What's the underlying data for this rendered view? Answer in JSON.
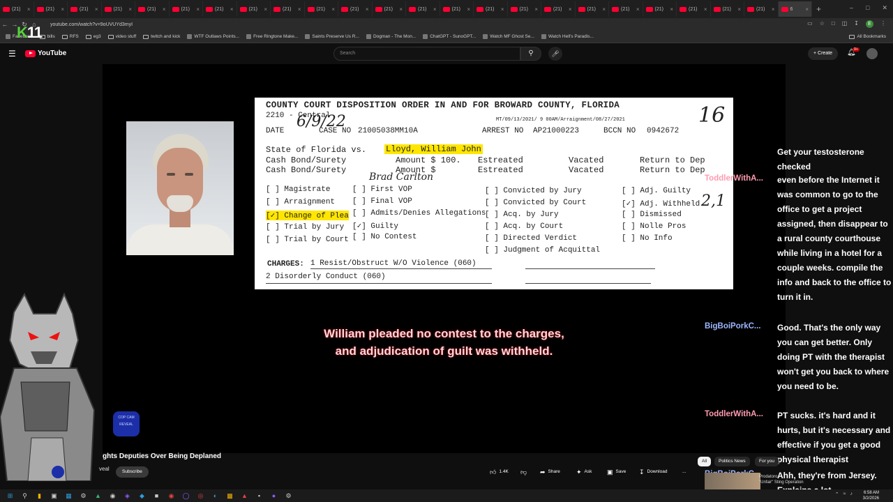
{
  "browser": {
    "tabs": [
      "(21)",
      "(21)",
      "(21)",
      "(21)",
      "(21)",
      "(21)",
      "(21)",
      "(21)",
      "(21)",
      "(21)",
      "(21)",
      "(21)",
      "(21)",
      "(21)",
      "(21)",
      "(21)",
      "(21)",
      "(21)",
      "(21)",
      "(21)",
      "(21)",
      "(21)",
      "(21)"
    ],
    "active_tab": "6",
    "new_tab": "+",
    "url": "youtube.com/watch?v=9oUVUYd3myI",
    "bookmarks": [
      "Facebook",
      "bills",
      "RFS",
      "eg3",
      "video stuff",
      "twitch and kick",
      "WTF Outlaws Points...",
      "Free Ringtone Make...",
      "Saints Preserve Us R...",
      "Dogman - The Mon...",
      "ChatGPT - SunoGPT...",
      "Watch MF Ghost Se...",
      "Watch Hell's Paradis..."
    ],
    "all_bookmarks": "All Bookmarks",
    "profile_initial": "E"
  },
  "overlay": {
    "logo_k": "K",
    "logo_num": "11"
  },
  "youtube": {
    "logo": "YouTube",
    "search_placeholder": "Search",
    "create": "Create",
    "notif_badge": "9+"
  },
  "document": {
    "title": "COUNTY COURT DISPOSITION ORDER IN AND FOR BROWARD COUNTY, FLORIDA",
    "code": "2210 - Central",
    "date_label": "DATE",
    "date_hw": "6/9/22",
    "case_label": "CASE NO",
    "case_no": "21005038MM10A",
    "arrest_meta": "MT/09/13/2021/  9 00AM/Arraignment/08/27/2021",
    "arrest_label": "ARREST NO",
    "arrest_no": "AP21000223",
    "bccn_label": "BCCN NO",
    "bccn_no": "0942672",
    "page_hw": "16",
    "state_line": "State of Florida vs.",
    "defendant": "Lloyd, William John",
    "bond1": "Cash Bond/Surety",
    "amount1": "Amount $ 100.",
    "estreated": "Estreated",
    "vacated": "Vacated",
    "return_dep": "Return to Dep",
    "bond2": "Cash Bond/Surety",
    "amount2": "Amount $",
    "judge_hw": "Brad Carlton",
    "col1": [
      "[ ] Magistrate",
      "[ ] Arraignment",
      "[✓] Change of Plea",
      "[ ] Trial by Jury",
      "[ ] Trial by Court"
    ],
    "col2": [
      "[ ] First VOP",
      "[ ] Final VOP",
      "[ ] Admits/Denies Allegations",
      "[✓] Guilty",
      "[ ] No Contest"
    ],
    "col3": [
      "[ ] Convicted by Jury",
      "[ ] Convicted by Court",
      "[ ] Acq. by Jury",
      "[ ] Acq. by Court",
      "[ ] Directed Verdict",
      "[ ] Judgment of Acquittal"
    ],
    "col4": [
      "[ ] Adj. Guilty",
      "[✓] Adj. Withheld",
      "[ ] Dismissed",
      "[ ] Nolle Pros",
      "[ ] No Info"
    ],
    "adj_hw": "2,1",
    "charges_label": "CHARGES:",
    "charge1": "1 Resist/Obstruct W/O Violence (060)",
    "charge2": "2 Disorderly Conduct (060)"
  },
  "subtitle": {
    "line1": "William pleaded no contest to the charges,",
    "line2": "and adjudication of guilt was withheld."
  },
  "badge": "COP CAM REVEAL",
  "chat": [
    {
      "user": "",
      "text": "Get your testosterone checked",
      "color": "#ff9bb0"
    },
    {
      "user": "ToddlerWithA...",
      "text": "even before the Internet it was common to go to the office to get a project assigned, then disappear to a rural county courthouse while living in a hotel for a couple weeks. compile the info and back to the office to turn it in.",
      "color": "#ff9bb0"
    },
    {
      "user": "BigBoiPorkC...",
      "text": "Good. That's the only way you can get better. Only doing PT with the therapist won't get you back to where you need to be.",
      "color": "#9fb6ff"
    },
    {
      "user": "ToddlerWithA...",
      "text": "PT sucks. it's hard and it hurts, but it's necessary and effective if you get a good physical therapist",
      "color": "#ff9bb0"
    },
    {
      "user": "BigBoiPorkC...",
      "text": "Ahh, they're from Jersey. Explains a lot",
      "color": "#9fb6ff"
    }
  ],
  "video_info": {
    "title": "ghts Deputies Over Being Deplaned",
    "channel": "veal",
    "channel_sub": "10",
    "subscribe": "Subscribe",
    "likes": "1.4K",
    "share": "Share",
    "ask": "Ask",
    "save": "Save",
    "download": "Download",
    "more": "..."
  },
  "filters": [
    "All",
    "Politics News",
    "For you"
  ],
  "recommended": {
    "line1": "Prodatoro",
    "line2": "\"Unfair\" Sting Operation"
  },
  "clock": {
    "time": "6:58 AM",
    "date": "3/2/2026"
  }
}
